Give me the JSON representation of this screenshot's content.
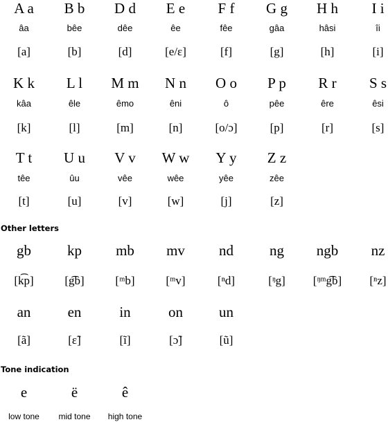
{
  "alphabet": [
    {
      "letter": "A a",
      "name": "âa",
      "ipa": "[a]"
    },
    {
      "letter": "B b",
      "name": "bêe",
      "ipa": "[b]"
    },
    {
      "letter": "D d",
      "name": "dêe",
      "ipa": "[d]"
    },
    {
      "letter": "E e",
      "name": "êe",
      "ipa": "[e/ɛ]"
    },
    {
      "letter": "F f",
      "name": "fêe",
      "ipa": "[f]"
    },
    {
      "letter": "G g",
      "name": "gâa",
      "ipa": "[g]"
    },
    {
      "letter": "H h",
      "name": "hâsi",
      "ipa": "[h]"
    },
    {
      "letter": "I i",
      "name": "îi",
      "ipa": "[i]"
    },
    {
      "letter": "K k",
      "name": "kâa",
      "ipa": "[k]"
    },
    {
      "letter": "L l",
      "name": "êle",
      "ipa": "[l]"
    },
    {
      "letter": "M m",
      "name": "êmo",
      "ipa": "[m]"
    },
    {
      "letter": "N n",
      "name": "êni",
      "ipa": "[n]"
    },
    {
      "letter": "O o",
      "name": "ô",
      "ipa": "[o/ɔ]"
    },
    {
      "letter": "P p",
      "name": "pêe",
      "ipa": "[p]"
    },
    {
      "letter": "R r",
      "name": "êre",
      "ipa": "[r]"
    },
    {
      "letter": "S s",
      "name": "êsi",
      "ipa": "[s]"
    },
    {
      "letter": "T t",
      "name": "têe",
      "ipa": "[t]"
    },
    {
      "letter": "U u",
      "name": "ûu",
      "ipa": "[u]"
    },
    {
      "letter": "V v",
      "name": "vêe",
      "ipa": "[v]"
    },
    {
      "letter": "W w",
      "name": "wêe",
      "ipa": "[w]"
    },
    {
      "letter": "Y y",
      "name": "yêe",
      "ipa": "[j]"
    },
    {
      "letter": "Z z",
      "name": "zêe",
      "ipa": "[z]"
    }
  ],
  "other_letters": {
    "heading": "Other letters",
    "consonants": [
      {
        "letter": "gb",
        "ipa": "[k͡p]"
      },
      {
        "letter": "kp",
        "ipa": "[g͡b]"
      },
      {
        "letter": "mb",
        "ipa": "[ᵐb]"
      },
      {
        "letter": "mv",
        "ipa": "[ᵐv]"
      },
      {
        "letter": "nd",
        "ipa": "[ⁿd]"
      },
      {
        "letter": "ng",
        "ipa": "[ᵑg]"
      },
      {
        "letter": "ngb",
        "ipa": "[ᵑᵐg͡b]"
      },
      {
        "letter": "nz",
        "ipa": "[ⁿz]"
      }
    ],
    "nasal_vowels": [
      {
        "letter": "an",
        "ipa": "[ã]"
      },
      {
        "letter": "en",
        "ipa": "[ɛ̃]"
      },
      {
        "letter": "in",
        "ipa": "[ĩ]"
      },
      {
        "letter": "on",
        "ipa": "[ɔ̃]"
      },
      {
        "letter": "un",
        "ipa": "[ũ]"
      }
    ]
  },
  "tone_indication": {
    "heading": "Tone indication",
    "tones": [
      {
        "letter": "e",
        "label": "low tone"
      },
      {
        "letter": "ë",
        "label": "mid tone"
      },
      {
        "letter": "ê",
        "label": "high tone"
      }
    ]
  }
}
